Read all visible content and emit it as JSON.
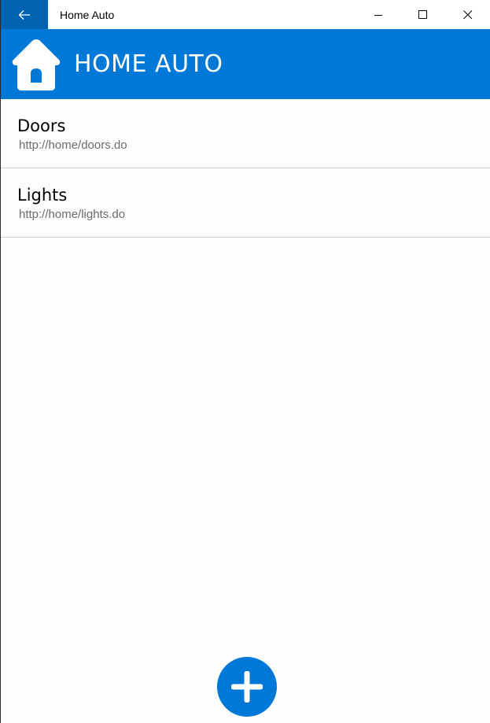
{
  "window": {
    "title": "Home Auto"
  },
  "titlebar": {
    "back_icon": "arrow-left-icon",
    "minimize_icon": "minimize-icon",
    "maximize_icon": "maximize-icon",
    "close_icon": "close-icon"
  },
  "header": {
    "logo_icon": "house-icon",
    "title": "HOME AUTO"
  },
  "list": {
    "items": [
      {
        "title": "Doors",
        "url": "http://home/doors.do"
      },
      {
        "title": "Lights",
        "url": "http://home/lights.do"
      }
    ]
  },
  "fab": {
    "icon": "plus-icon"
  },
  "colors": {
    "accent": "#0078d7",
    "back_button": "#0063b1",
    "divider": "#d0d0d0",
    "secondary_text": "#6b6b6b"
  }
}
